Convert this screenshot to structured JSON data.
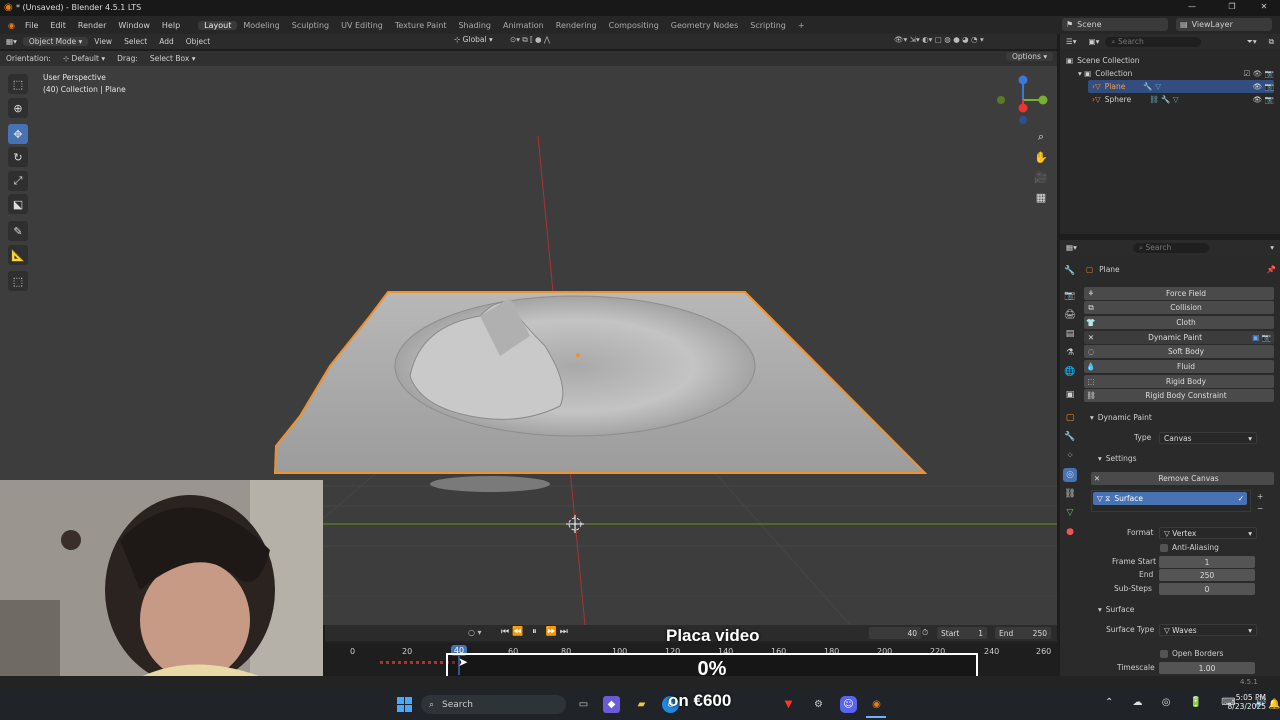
{
  "window": {
    "title": "* (Unsaved) - Blender 4.5.1 LTS",
    "controls": [
      "—",
      "❐",
      "✕"
    ]
  },
  "menus": [
    "File",
    "Edit",
    "Render",
    "Window",
    "Help"
  ],
  "workspaces": [
    "Layout",
    "Modeling",
    "Sculpting",
    "UV Editing",
    "Texture Paint",
    "Shading",
    "Animation",
    "Rendering",
    "Compositing",
    "Geometry Nodes",
    "Scripting"
  ],
  "workspace_add": "+",
  "scene": {
    "label": "Scene",
    "view_layer": "ViewLayer"
  },
  "viewport_header": {
    "mode": "Object Mode",
    "items": [
      "View",
      "Select",
      "Add",
      "Object"
    ],
    "transform": "Global",
    "options": "Options"
  },
  "tool_settings": {
    "orientation_label": "Orientation:",
    "orientation": "Default",
    "drag_label": "Drag:",
    "drag": "Select Box"
  },
  "overlay": {
    "perspective": "User Perspective",
    "collection": "(40) Collection | Plane"
  },
  "outliner": {
    "search_placeholder": "Search",
    "scene_collection": "Scene Collection",
    "collection": "Collection",
    "objects": [
      "Plane",
      "Sphere"
    ]
  },
  "properties": {
    "search_placeholder": "Search",
    "object": "Plane",
    "physics_buttons": [
      "Force Field",
      "Collision",
      "Cloth",
      "Dynamic Paint",
      "Soft Body",
      "Fluid",
      "Rigid Body",
      "Rigid Body Constraint"
    ],
    "dynamic_paint": {
      "title": "Dynamic Paint",
      "type_label": "Type",
      "type": "Canvas",
      "settings": "Settings",
      "remove": "Remove Canvas",
      "surface": "Surface"
    },
    "surface_settings": {
      "format_label": "Format",
      "format": "Vertex",
      "aa": "Anti-Aliasing",
      "frame_start_label": "Frame Start",
      "frame_start": "1",
      "end_label": "End",
      "end": "250",
      "substeps_label": "Sub-Steps",
      "substeps": "0"
    },
    "surface": {
      "title": "Surface",
      "type_label": "Surface Type",
      "type": "Waves",
      "open_borders": "Open Borders",
      "timescale_label": "Timescale",
      "timescale": "1.00"
    }
  },
  "timeline": {
    "current": "40",
    "start_label": "Start",
    "start": "1",
    "end_label": "End",
    "end": "250",
    "ticks": [
      "0",
      "20",
      "40",
      "60",
      "80",
      "100",
      "120",
      "140",
      "160",
      "180",
      "200",
      "220",
      "240",
      "260"
    ],
    "playhead": "40"
  },
  "overlay_video": {
    "title": "Placa video",
    "progress_text": "0%"
  },
  "status": {
    "version": "4.5.1"
  },
  "taskbar": {
    "search": "Search",
    "price": "on €600",
    "time": "5:05 PM",
    "date": "8/23/2025"
  },
  "colors": {
    "accent": "#4772b3",
    "selection": "#f0912a",
    "panel": "#2a2a2a",
    "viewport": "#3d3d3d"
  }
}
